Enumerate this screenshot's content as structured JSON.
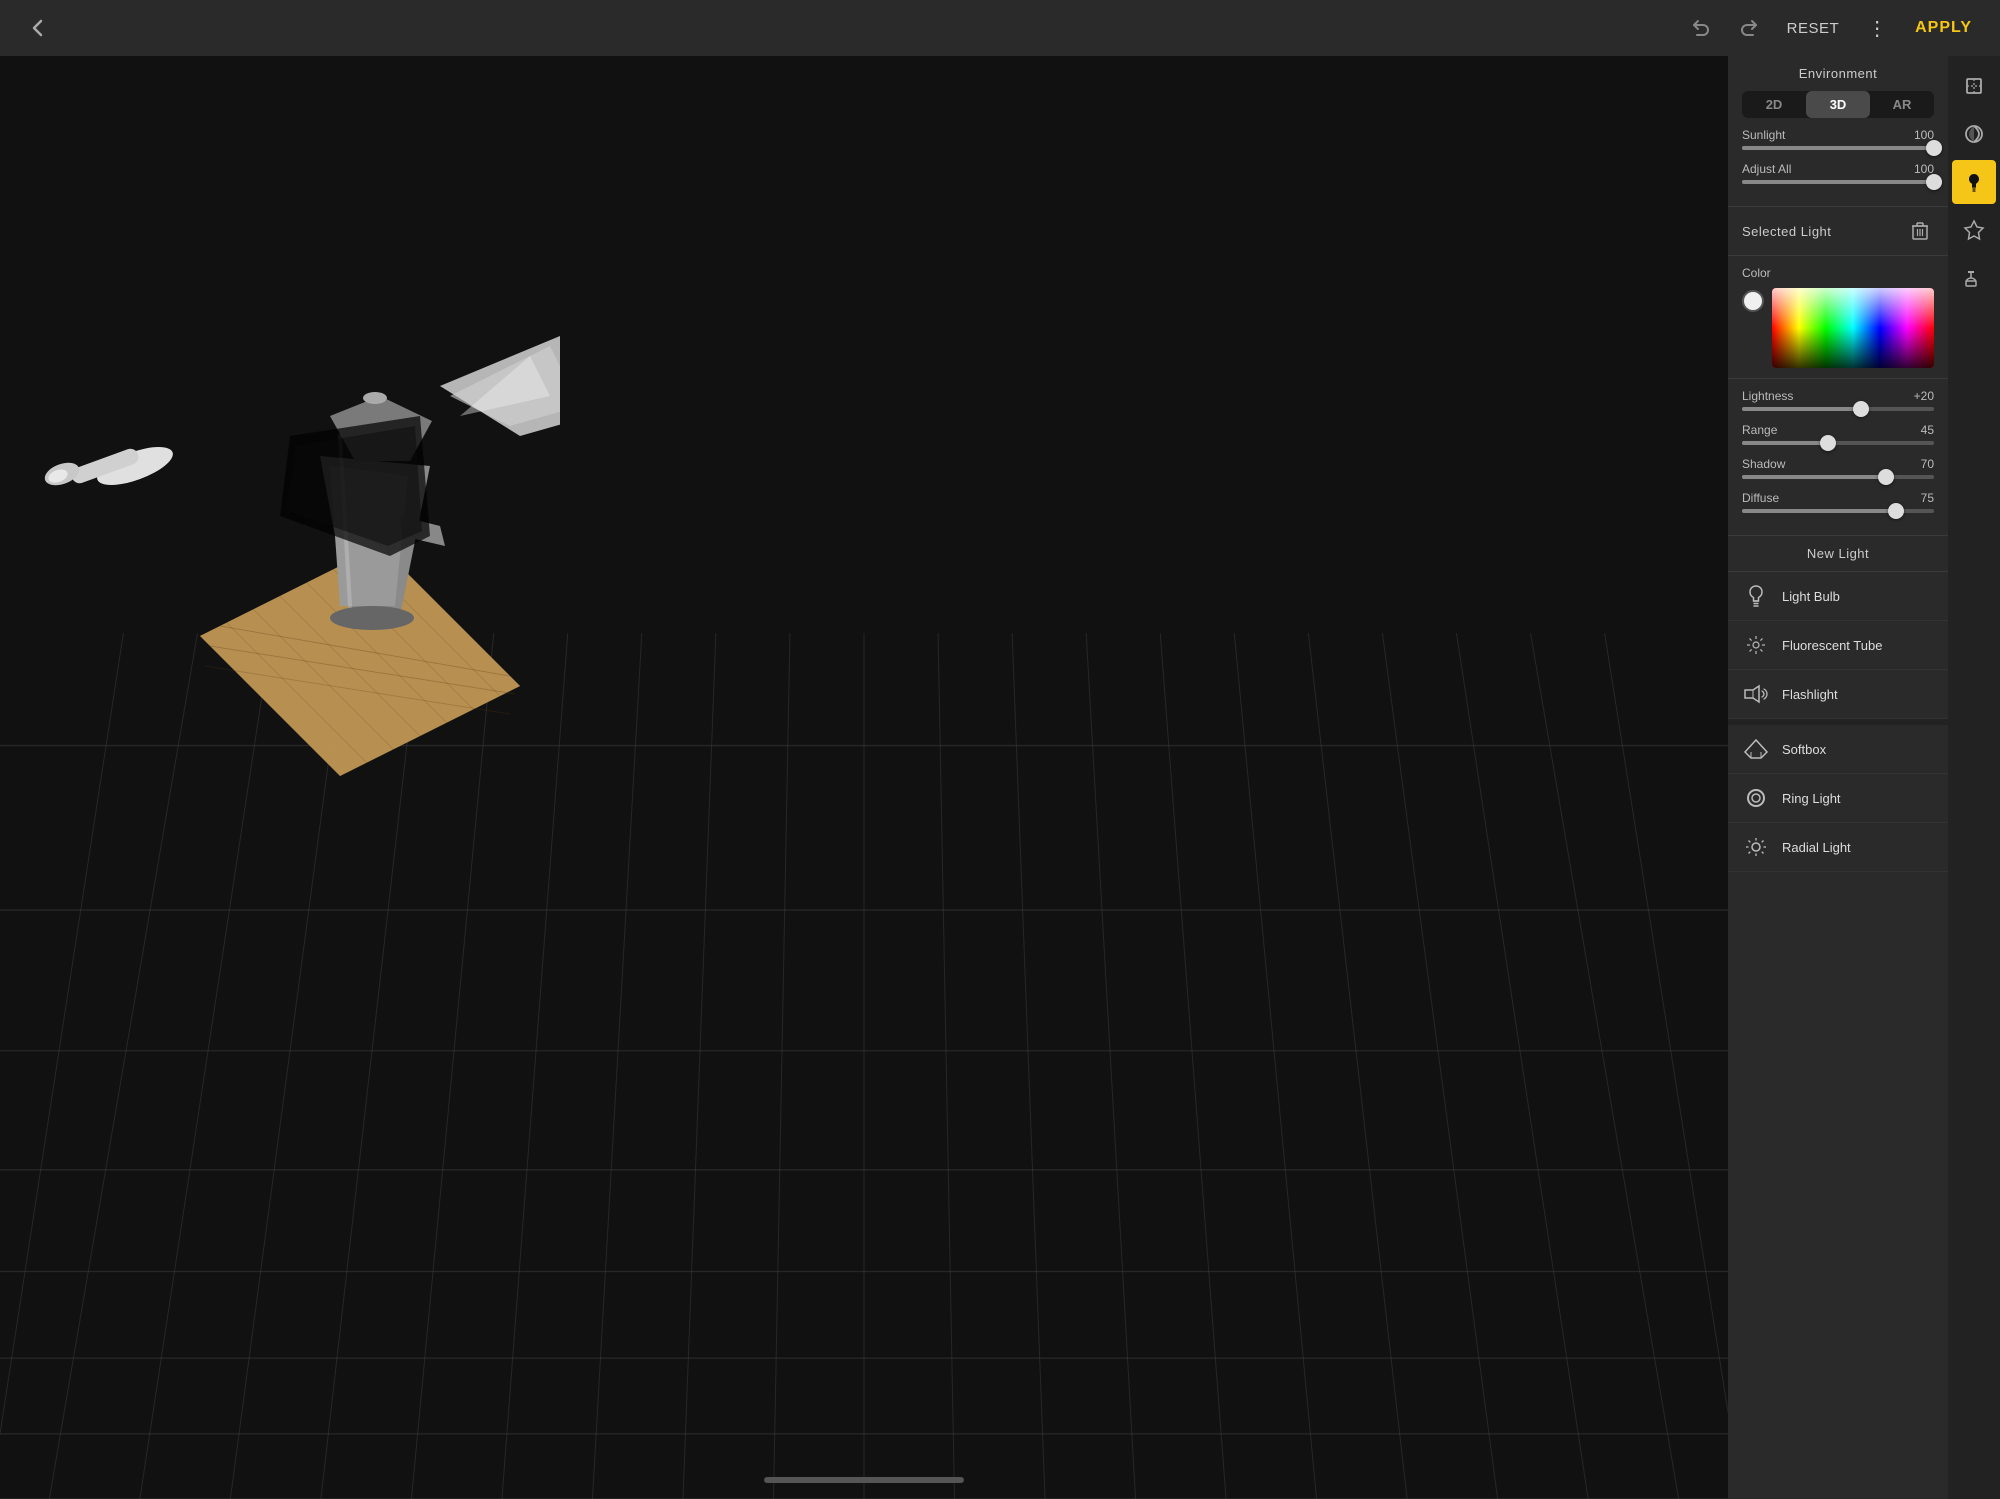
{
  "topbar": {
    "back_label": "‹",
    "undo_icon": "undo",
    "redo_icon": "redo",
    "reset_label": "RESET",
    "more_label": "⋮",
    "apply_label": "APPLY"
  },
  "right_toolbar": {
    "icons": [
      {
        "name": "crop-icon",
        "symbol": "⊡",
        "active": false
      },
      {
        "name": "adjust-icon",
        "symbol": "◑",
        "active": false
      },
      {
        "name": "light-icon",
        "symbol": "💡",
        "active": true
      },
      {
        "name": "pin-icon",
        "symbol": "📌",
        "active": false
      },
      {
        "name": "paint-icon",
        "symbol": "🖌",
        "active": false
      }
    ]
  },
  "panel": {
    "environment_title": "Environment",
    "view_modes": [
      {
        "label": "2D",
        "active": false
      },
      {
        "label": "3D",
        "active": true
      },
      {
        "label": "AR",
        "active": false
      }
    ],
    "sunlight": {
      "label": "Sunlight",
      "value": 100,
      "percent": 100
    },
    "adjust_all": {
      "label": "Adjust All",
      "value": 100,
      "percent": 100
    },
    "selected_light": {
      "title": "Selected Light",
      "delete_icon": "🗑"
    },
    "color": {
      "label": "Color"
    },
    "lightness": {
      "label": "Lightness",
      "value": "+20",
      "percent": 62
    },
    "range": {
      "label": "Range",
      "value": 45,
      "percent": 45
    },
    "shadow": {
      "label": "Shadow",
      "value": 70,
      "percent": 75
    },
    "diffuse": {
      "label": "Diffuse",
      "value": 75,
      "percent": 80
    },
    "new_light_title": "New Light",
    "light_types": [
      {
        "label": "Light Bulb",
        "icon": "bulb"
      },
      {
        "label": "Fluorescent Tube",
        "icon": "tube"
      },
      {
        "label": "Flashlight",
        "icon": "flashlight"
      },
      {
        "label": "Softbox",
        "icon": "softbox"
      },
      {
        "label": "Ring Light",
        "icon": "ring"
      },
      {
        "label": "Radial Light",
        "icon": "radial"
      }
    ]
  },
  "bottom_bar": {
    "indicator": "—"
  }
}
